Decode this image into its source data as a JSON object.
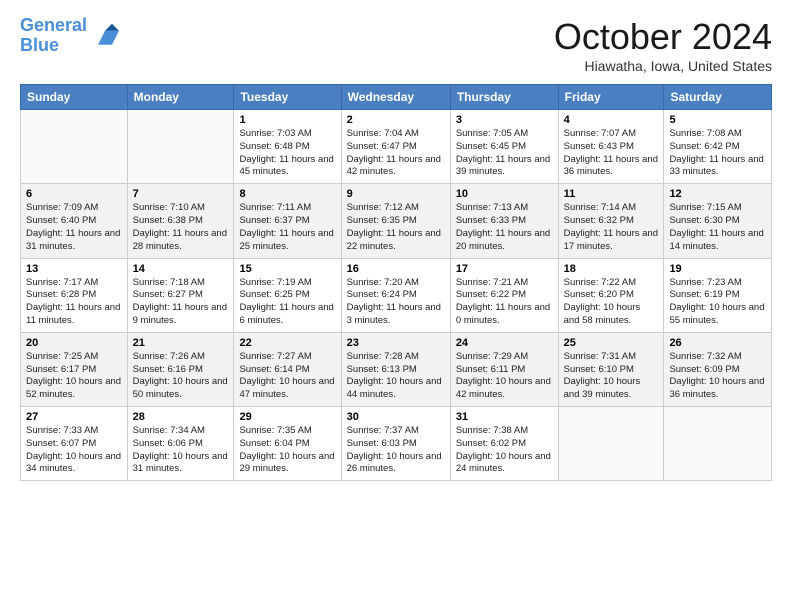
{
  "header": {
    "logo_line1": "General",
    "logo_line2": "Blue",
    "title": "October 2024",
    "location": "Hiawatha, Iowa, United States"
  },
  "weekdays": [
    "Sunday",
    "Monday",
    "Tuesday",
    "Wednesday",
    "Thursday",
    "Friday",
    "Saturday"
  ],
  "weeks": [
    [
      {
        "day": "",
        "info": ""
      },
      {
        "day": "",
        "info": ""
      },
      {
        "day": "1",
        "info": "Sunrise: 7:03 AM\nSunset: 6:48 PM\nDaylight: 11 hours and 45 minutes."
      },
      {
        "day": "2",
        "info": "Sunrise: 7:04 AM\nSunset: 6:47 PM\nDaylight: 11 hours and 42 minutes."
      },
      {
        "day": "3",
        "info": "Sunrise: 7:05 AM\nSunset: 6:45 PM\nDaylight: 11 hours and 39 minutes."
      },
      {
        "day": "4",
        "info": "Sunrise: 7:07 AM\nSunset: 6:43 PM\nDaylight: 11 hours and 36 minutes."
      },
      {
        "day": "5",
        "info": "Sunrise: 7:08 AM\nSunset: 6:42 PM\nDaylight: 11 hours and 33 minutes."
      }
    ],
    [
      {
        "day": "6",
        "info": "Sunrise: 7:09 AM\nSunset: 6:40 PM\nDaylight: 11 hours and 31 minutes."
      },
      {
        "day": "7",
        "info": "Sunrise: 7:10 AM\nSunset: 6:38 PM\nDaylight: 11 hours and 28 minutes."
      },
      {
        "day": "8",
        "info": "Sunrise: 7:11 AM\nSunset: 6:37 PM\nDaylight: 11 hours and 25 minutes."
      },
      {
        "day": "9",
        "info": "Sunrise: 7:12 AM\nSunset: 6:35 PM\nDaylight: 11 hours and 22 minutes."
      },
      {
        "day": "10",
        "info": "Sunrise: 7:13 AM\nSunset: 6:33 PM\nDaylight: 11 hours and 20 minutes."
      },
      {
        "day": "11",
        "info": "Sunrise: 7:14 AM\nSunset: 6:32 PM\nDaylight: 11 hours and 17 minutes."
      },
      {
        "day": "12",
        "info": "Sunrise: 7:15 AM\nSunset: 6:30 PM\nDaylight: 11 hours and 14 minutes."
      }
    ],
    [
      {
        "day": "13",
        "info": "Sunrise: 7:17 AM\nSunset: 6:28 PM\nDaylight: 11 hours and 11 minutes."
      },
      {
        "day": "14",
        "info": "Sunrise: 7:18 AM\nSunset: 6:27 PM\nDaylight: 11 hours and 9 minutes."
      },
      {
        "day": "15",
        "info": "Sunrise: 7:19 AM\nSunset: 6:25 PM\nDaylight: 11 hours and 6 minutes."
      },
      {
        "day": "16",
        "info": "Sunrise: 7:20 AM\nSunset: 6:24 PM\nDaylight: 11 hours and 3 minutes."
      },
      {
        "day": "17",
        "info": "Sunrise: 7:21 AM\nSunset: 6:22 PM\nDaylight: 11 hours and 0 minutes."
      },
      {
        "day": "18",
        "info": "Sunrise: 7:22 AM\nSunset: 6:20 PM\nDaylight: 10 hours and 58 minutes."
      },
      {
        "day": "19",
        "info": "Sunrise: 7:23 AM\nSunset: 6:19 PM\nDaylight: 10 hours and 55 minutes."
      }
    ],
    [
      {
        "day": "20",
        "info": "Sunrise: 7:25 AM\nSunset: 6:17 PM\nDaylight: 10 hours and 52 minutes."
      },
      {
        "day": "21",
        "info": "Sunrise: 7:26 AM\nSunset: 6:16 PM\nDaylight: 10 hours and 50 minutes."
      },
      {
        "day": "22",
        "info": "Sunrise: 7:27 AM\nSunset: 6:14 PM\nDaylight: 10 hours and 47 minutes."
      },
      {
        "day": "23",
        "info": "Sunrise: 7:28 AM\nSunset: 6:13 PM\nDaylight: 10 hours and 44 minutes."
      },
      {
        "day": "24",
        "info": "Sunrise: 7:29 AM\nSunset: 6:11 PM\nDaylight: 10 hours and 42 minutes."
      },
      {
        "day": "25",
        "info": "Sunrise: 7:31 AM\nSunset: 6:10 PM\nDaylight: 10 hours and 39 minutes."
      },
      {
        "day": "26",
        "info": "Sunrise: 7:32 AM\nSunset: 6:09 PM\nDaylight: 10 hours and 36 minutes."
      }
    ],
    [
      {
        "day": "27",
        "info": "Sunrise: 7:33 AM\nSunset: 6:07 PM\nDaylight: 10 hours and 34 minutes."
      },
      {
        "day": "28",
        "info": "Sunrise: 7:34 AM\nSunset: 6:06 PM\nDaylight: 10 hours and 31 minutes."
      },
      {
        "day": "29",
        "info": "Sunrise: 7:35 AM\nSunset: 6:04 PM\nDaylight: 10 hours and 29 minutes."
      },
      {
        "day": "30",
        "info": "Sunrise: 7:37 AM\nSunset: 6:03 PM\nDaylight: 10 hours and 26 minutes."
      },
      {
        "day": "31",
        "info": "Sunrise: 7:38 AM\nSunset: 6:02 PM\nDaylight: 10 hours and 24 minutes."
      },
      {
        "day": "",
        "info": ""
      },
      {
        "day": "",
        "info": ""
      }
    ]
  ]
}
